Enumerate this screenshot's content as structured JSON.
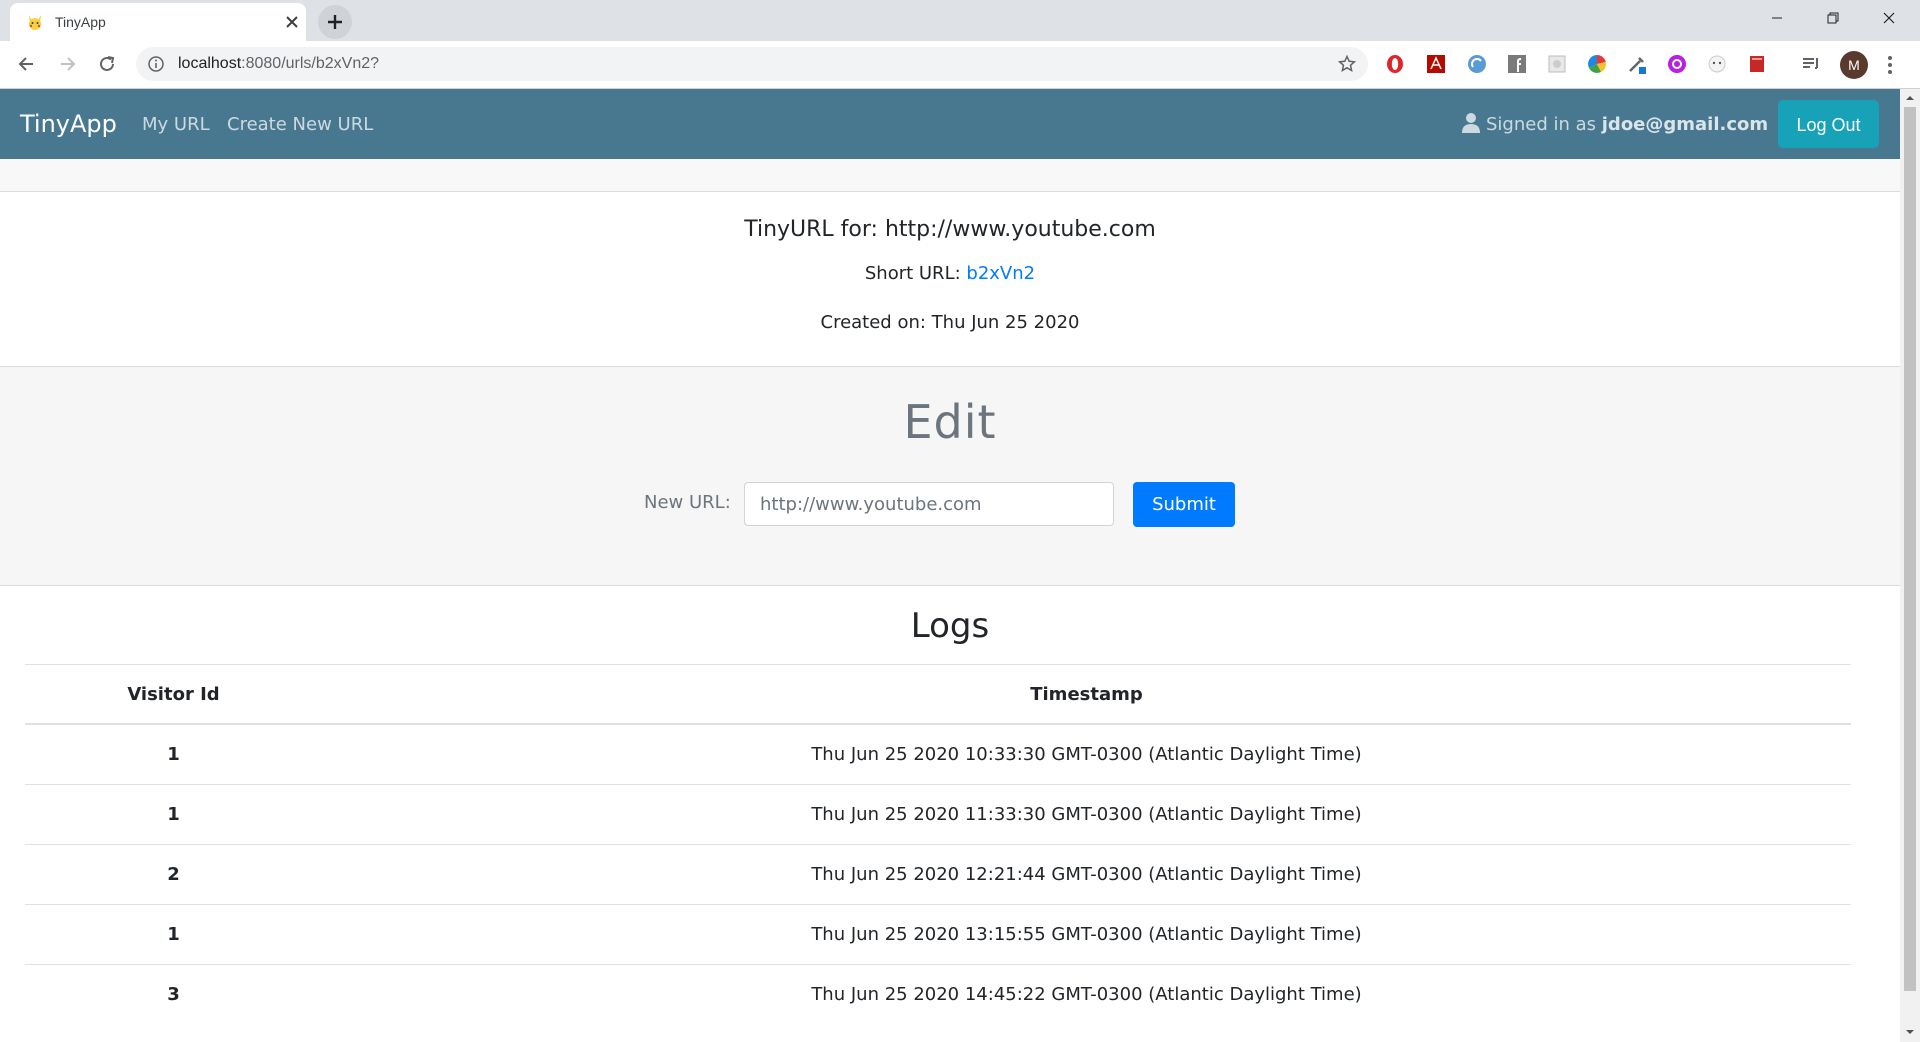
{
  "browser": {
    "tab_title": "TinyApp",
    "url_host": "localhost",
    "url_path": ":8080/urls/b2xVn2?",
    "profile_initial": "M"
  },
  "navbar": {
    "brand": "TinyApp",
    "links": [
      "My URL",
      "Create New URL"
    ],
    "signed_in_prefix": "Signed in as",
    "signed_in_email": "jdoe@gmail.com",
    "logout_label": "Log Out",
    "bg_color": "#48788f",
    "logout_color": "#17a2b8"
  },
  "url_info": {
    "title": "TinyURL for: http://www.youtube.com",
    "short_label": "Short URL:",
    "short_code": "b2xVn2",
    "created": "Created on: Thu Jun 25 2020"
  },
  "edit": {
    "title": "Edit",
    "new_url_label": "New URL:",
    "new_url_placeholder": "http://www.youtube.com",
    "submit_label": "Submit",
    "submit_color": "#007bff"
  },
  "logs": {
    "title": "Logs",
    "columns": [
      "Visitor Id",
      "Timestamp"
    ],
    "rows": [
      {
        "visitor_id": "1",
        "timestamp": "Thu Jun 25 2020 10:33:30 GMT-0300 (Atlantic Daylight Time)"
      },
      {
        "visitor_id": "1",
        "timestamp": "Thu Jun 25 2020 11:33:30 GMT-0300 (Atlantic Daylight Time)"
      },
      {
        "visitor_id": "2",
        "timestamp": "Thu Jun 25 2020 12:21:44 GMT-0300 (Atlantic Daylight Time)"
      },
      {
        "visitor_id": "1",
        "timestamp": "Thu Jun 25 2020 13:15:55 GMT-0300 (Atlantic Daylight Time)"
      },
      {
        "visitor_id": "3",
        "timestamp": "Thu Jun 25 2020 14:45:22 GMT-0300 (Atlantic Daylight Time)"
      }
    ]
  }
}
